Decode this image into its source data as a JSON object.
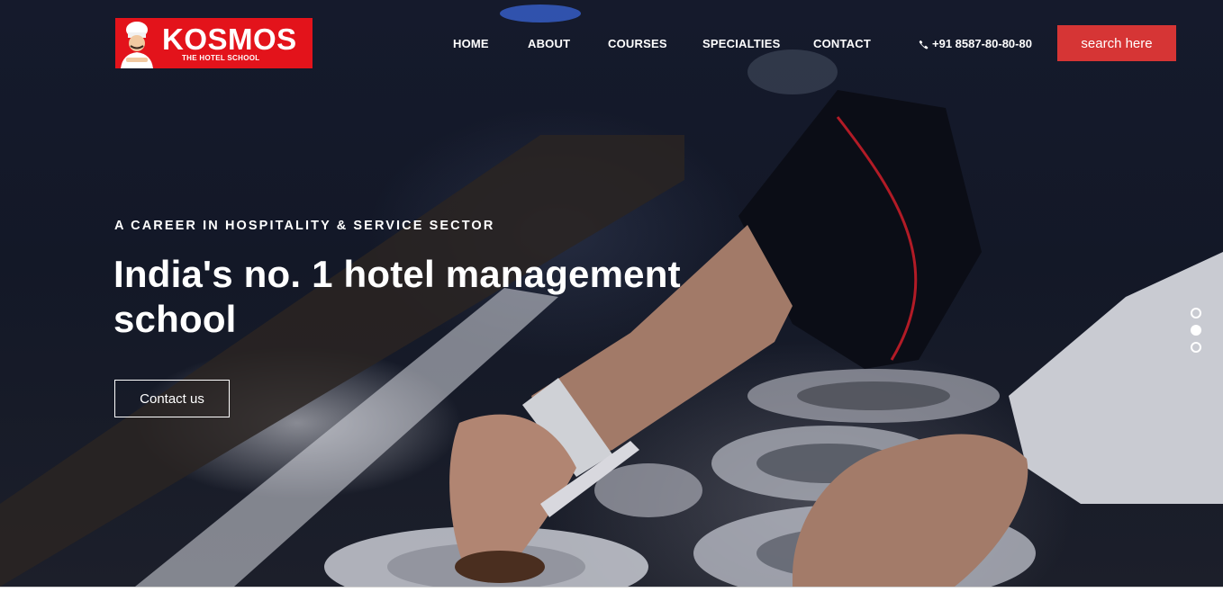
{
  "brand": {
    "name": "KOSMOS",
    "tagline": "THE HOTEL SCHOOL",
    "color": "#e3131b"
  },
  "nav": {
    "items": [
      {
        "label": "HOME"
      },
      {
        "label": "ABOUT"
      },
      {
        "label": "COURSES"
      },
      {
        "label": "SPECIALTIES"
      },
      {
        "label": "CONTACT"
      }
    ],
    "phone": "+91 8587-80-80-80",
    "phone_icon": "phone-icon",
    "search_label": "search here",
    "search_color": "#d63535"
  },
  "hero": {
    "eyebrow": "A CAREER IN HOSPITALITY & SERVICE SECTOR",
    "headline_line1": "India's no. 1 hotel management",
    "headline_line2": "school",
    "cta_label": "Contact us",
    "slides": 3,
    "active_slide": 2
  }
}
